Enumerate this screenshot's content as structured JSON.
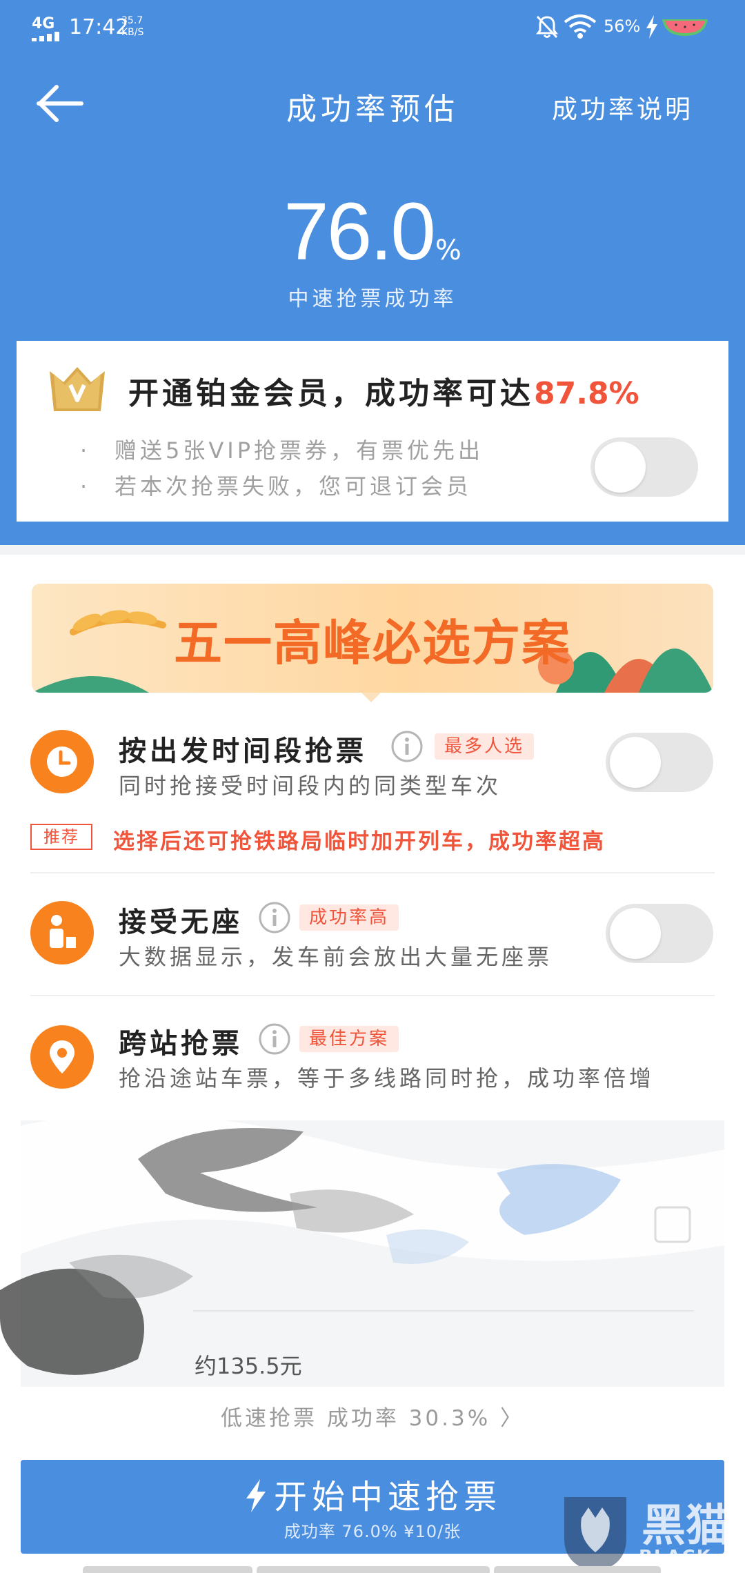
{
  "status_bar": {
    "network": "4G",
    "time": "17:42",
    "speed_value": "35.7",
    "speed_unit": "KB/S",
    "battery": "56%"
  },
  "nav": {
    "title": "成功率预估",
    "help": "成功率说明"
  },
  "rate": {
    "value": "76.0",
    "unit": "%",
    "label": "中速抢票成功率"
  },
  "vip": {
    "title": "开通铂金会员，成功率可达",
    "highlight": "87.8%",
    "bullet_dot": "·",
    "bullets": [
      "赠送5张VIP抢票券，有票优先出",
      "若本次抢票失败，您可退订会员"
    ],
    "toggle_on": false
  },
  "banner": {
    "text": "五一高峰必选方案"
  },
  "options": [
    {
      "title": "按出发时间段抢票",
      "tag": "最多人选",
      "desc": "同时抢接受时间段内的同类型车次",
      "icon": "clock-icon",
      "toggle_on": false
    },
    {
      "title": "接受无座",
      "tag": "成功率高",
      "desc": "大数据显示，发车前会放出大量无座票",
      "icon": "standing-person-icon",
      "toggle_on": false
    },
    {
      "title": "跨站抢票",
      "tag": "最佳方案",
      "desc": "抢沿途站车票，等于多线路同时抢，成功率倍增",
      "icon": "location-pin-icon"
    }
  ],
  "recommend": {
    "tag": "推荐",
    "text": "选择后还可抢铁路局临时加开列车，成功率超高"
  },
  "price": "约135.5元",
  "lowspeed": "低速抢票 成功率 30.3% 〉",
  "start": {
    "label": "开始中速抢票",
    "sub": "成功率 76.0% ¥10/张"
  },
  "watermark": {
    "cn": "黑猫",
    "en": "BLACK CAT"
  },
  "colors": {
    "primary": "#4a8ee0",
    "accent_red": "#f0543a",
    "icon_orange": "#f7821e"
  }
}
